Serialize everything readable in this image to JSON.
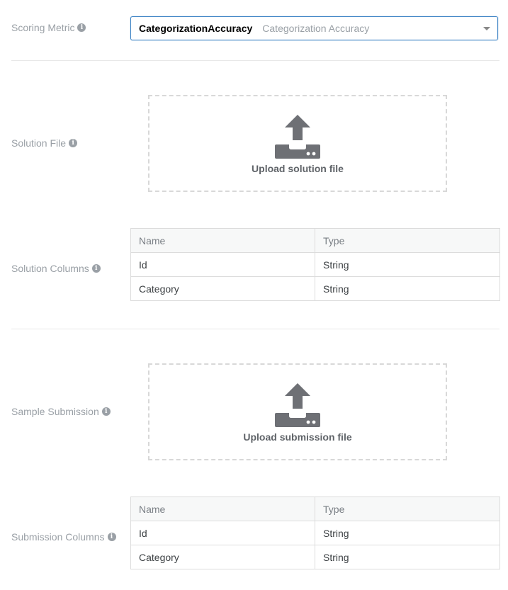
{
  "scoring": {
    "label": "Scoring Metric",
    "value": "CategorizationAccuracy",
    "value_description": "Categorization Accuracy"
  },
  "solution_file": {
    "label": "Solution File",
    "upload_label": "Upload solution file",
    "icon": "upload-icon"
  },
  "solution_columns": {
    "label": "Solution Columns",
    "headers": [
      "Name",
      "Type"
    ],
    "rows": [
      [
        "Id",
        "String"
      ],
      [
        "Category",
        "String"
      ]
    ]
  },
  "sample_submission": {
    "label": "Sample Submission",
    "upload_label": "Upload submission file",
    "icon": "upload-icon"
  },
  "submission_columns": {
    "label": "Submission Columns",
    "headers": [
      "Name",
      "Type"
    ],
    "rows": [
      [
        "Id",
        "String"
      ],
      [
        "Category",
        "String"
      ]
    ]
  },
  "colors": {
    "focus_border": "#3b82c4",
    "label_text": "#9aa0a6",
    "icon_fill": "#6e7075"
  }
}
